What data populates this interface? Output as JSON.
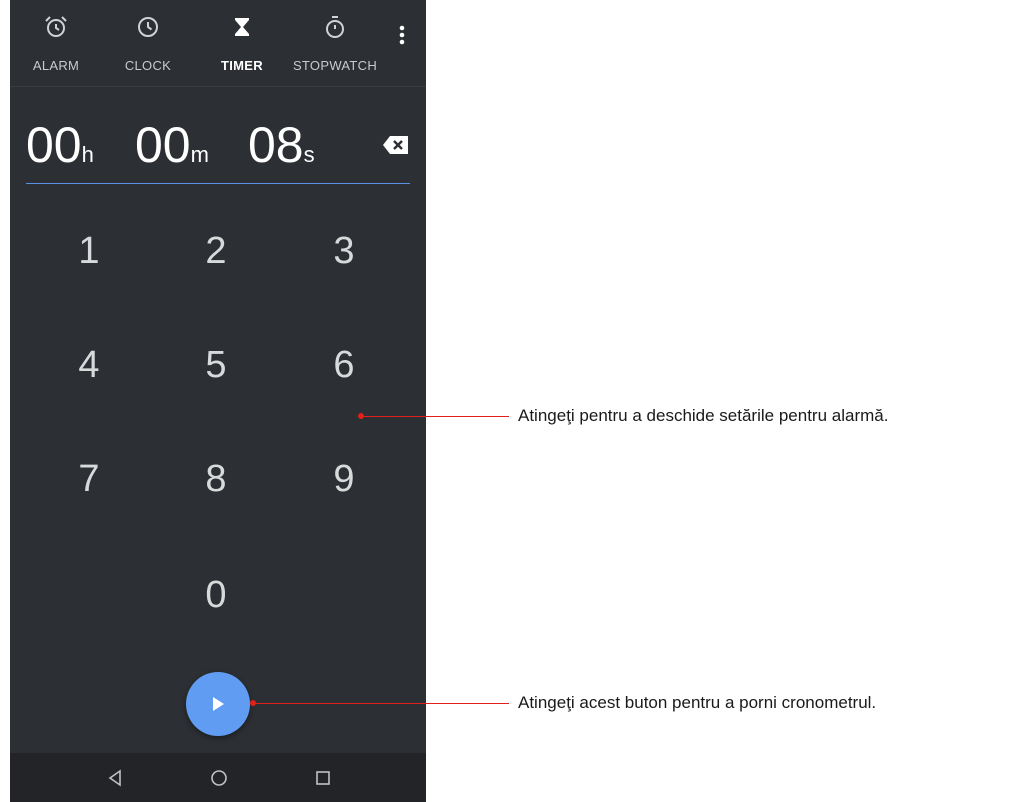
{
  "tabs": [
    {
      "label": "ALARM",
      "icon": "alarm-clock-icon"
    },
    {
      "label": "CLOCK",
      "icon": "clock-icon"
    },
    {
      "label": "TIMER",
      "icon": "hourglass-icon"
    },
    {
      "label": "STOPWATCH",
      "icon": "stopwatch-icon"
    }
  ],
  "active_tab": "TIMER",
  "timer": {
    "hours": "00",
    "hours_unit": "h",
    "minutes": "00",
    "minutes_unit": "m",
    "seconds": "08",
    "seconds_unit": "s"
  },
  "keypad": [
    "1",
    "2",
    "3",
    "4",
    "5",
    "6",
    "7",
    "8",
    "9",
    "0"
  ],
  "annotations": {
    "alarm_settings": "Atingeţi pentru a deschide setările pentru alarmă.",
    "start_button": "Atingeţi acest buton pentru a porni cronometrul."
  },
  "colors": {
    "background": "#2c2f33",
    "accent": "#5f9cf2",
    "callout": "#e0201b"
  }
}
